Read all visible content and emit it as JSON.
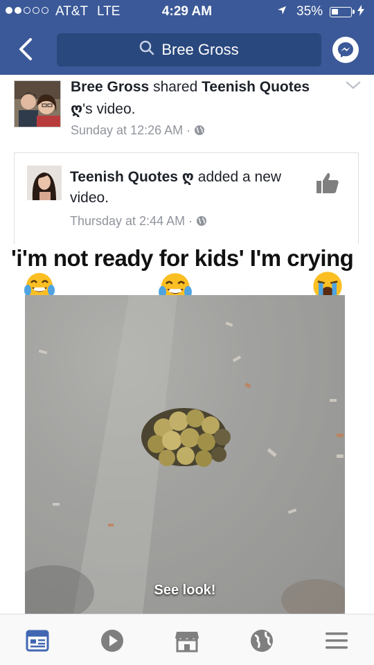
{
  "status_bar": {
    "carrier": "AT&T",
    "network": "LTE",
    "time": "4:29 AM",
    "battery_percent": "35%",
    "battery_level": 0.35
  },
  "header": {
    "search_text": "Bree Gross"
  },
  "story": {
    "actor": "Bree Gross",
    "action": "shared",
    "page": "Teenish Quotes ღ",
    "suffix": "'s video.",
    "time": "Sunday at 12:26 AM"
  },
  "shared_post": {
    "page": "Teenish Quotes ღ",
    "action": "added a new video.",
    "time": "Thursday at 2:44 AM"
  },
  "video": {
    "caption": "'i'm not ready for kids' I'm crying",
    "subtitle": "See look!"
  },
  "colors": {
    "brand": "#3b5998",
    "search_bg": "#29487d",
    "meta_text": "#90949c",
    "active_tab": "#4267b2",
    "inactive_tab": "#7f7f7f"
  },
  "icons": {
    "back": "chevron-left-icon",
    "search": "search-icon",
    "messenger": "messenger-icon",
    "more": "chevron-down-icon",
    "like": "thumbs-up-icon",
    "tabs": [
      "news-feed-icon",
      "video-icon",
      "marketplace-icon",
      "globe-icon",
      "menu-icon"
    ]
  }
}
